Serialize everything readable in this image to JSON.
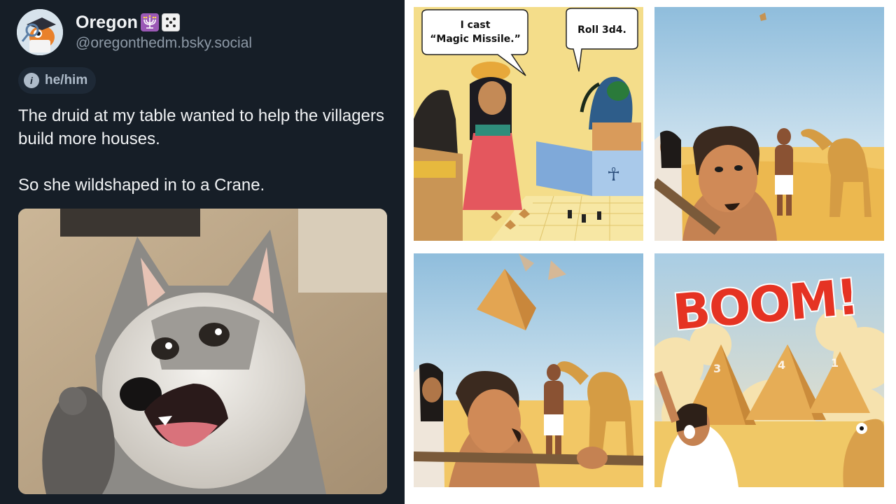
{
  "post": {
    "display_name": "Oregon",
    "name_emojis": [
      "menorah-emoji",
      "die-emoji"
    ],
    "handle": "@oregonthedm.bsky.social",
    "pronouns": "he/him",
    "pronoun_icon": "info-icon",
    "text": [
      "The druid at my table wanted to help the villagers build more houses.",
      "So she wildshaped in to a Crane."
    ],
    "colors": {
      "background": "#161e27",
      "text": "#f1f3f5",
      "muted": "#8d99a6",
      "pill_bg": "#1e2936"
    }
  },
  "comic": {
    "panel1": {
      "bubble_left": "I cast “Magic Missile.”",
      "bubble_right": "Roll 3d4."
    },
    "panel4": {
      "sfx": "BOOM!",
      "pyramid_numbers": [
        "3",
        "4",
        "1"
      ]
    },
    "colors": {
      "sky": "#a9cde4",
      "sand": "#f2c765",
      "boom": "#e53323"
    }
  }
}
